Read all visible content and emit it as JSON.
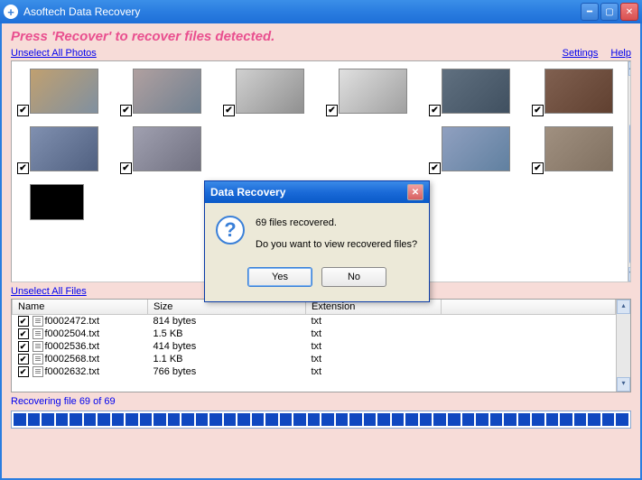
{
  "app": {
    "title": "Asoftech Data Recovery"
  },
  "instruction": "Press 'Recover' to recover files detected.",
  "links": {
    "unselect_photos": "Unselect All Photos",
    "unselect_files": "Unselect All Files",
    "settings": "Settings",
    "help": "Help"
  },
  "files": {
    "columns": {
      "name": "Name",
      "size": "Size",
      "ext": "Extension"
    },
    "rows": [
      {
        "name": "f0002472.txt",
        "size": "814 bytes",
        "ext": "txt"
      },
      {
        "name": "f0002504.txt",
        "size": "1.5 KB",
        "ext": "txt"
      },
      {
        "name": "f0002536.txt",
        "size": "414 bytes",
        "ext": "txt"
      },
      {
        "name": "f0002568.txt",
        "size": "1.1 KB",
        "ext": "txt"
      },
      {
        "name": "f0002632.txt",
        "size": "766 bytes",
        "ext": "txt"
      }
    ]
  },
  "progress": {
    "label": "Recovering file 69 of 69"
  },
  "dialog": {
    "title": "Data Recovery",
    "line1": "69 files recovered.",
    "line2": "Do you want to view recovered files?",
    "yes": "Yes",
    "no": "No"
  }
}
